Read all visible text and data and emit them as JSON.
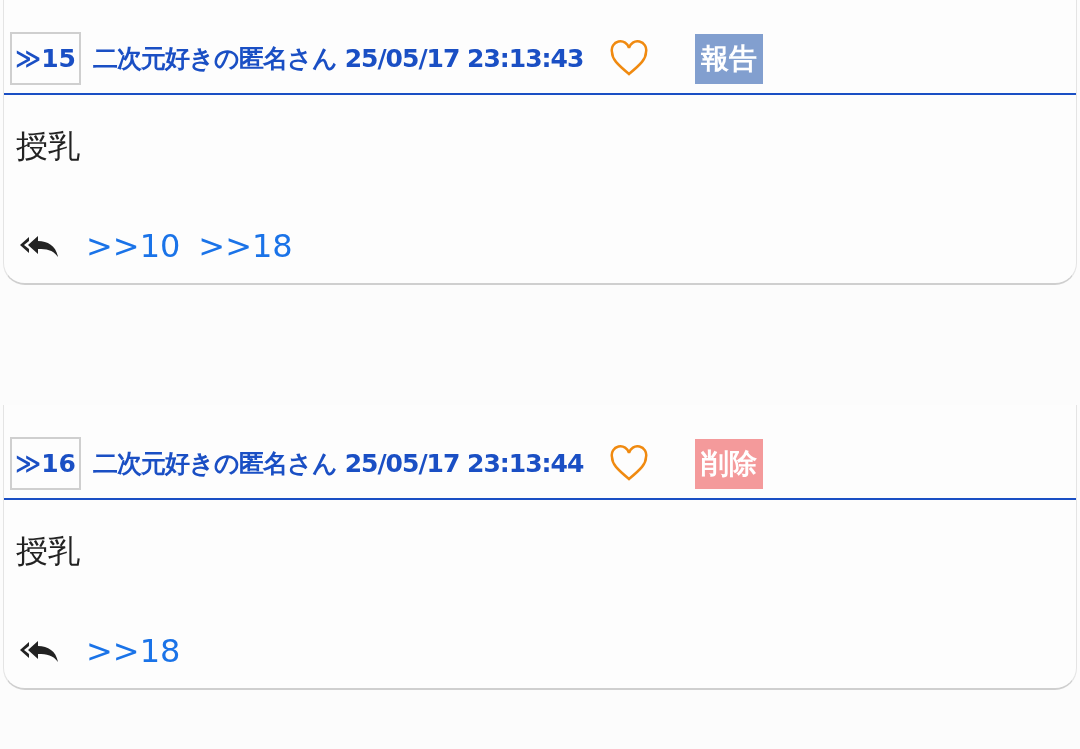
{
  "posts": [
    {
      "number": "≫15",
      "author": "二次元好きの匿名さん",
      "date": "25/05/17 23:13:43",
      "action": {
        "kind": "report",
        "label": "報告"
      },
      "body": "授乳",
      "replies": [
        ">>10",
        ">>18"
      ]
    },
    {
      "number": "≫16",
      "author": "二次元好きの匿名さん",
      "date": "25/05/17 23:13:44",
      "action": {
        "kind": "delete",
        "label": "削除"
      },
      "body": "授乳",
      "replies": [
        ">>18"
      ]
    }
  ]
}
